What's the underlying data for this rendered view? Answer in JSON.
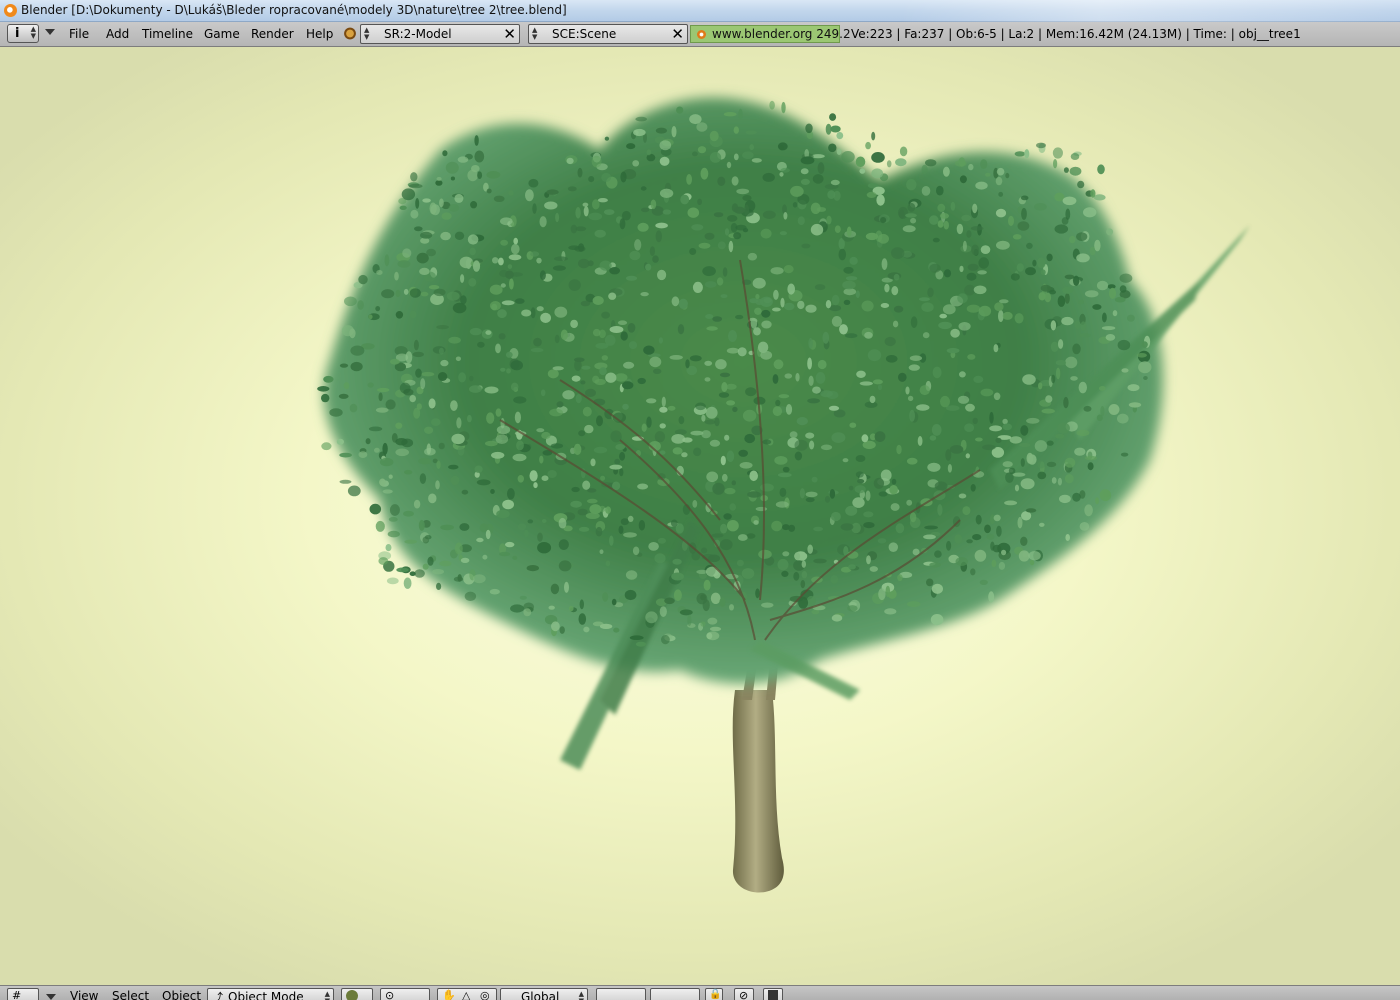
{
  "window": {
    "title": "Blender [D:\\Dokumenty - D\\Lukáš\\Bleder ropracované\\modely 3D\\nature\\tree 2\\tree.blend]",
    "app_icon": "blender-logo-icon"
  },
  "topbar": {
    "window_type_icon": "info-icon",
    "menus": [
      "File",
      "Add",
      "Timeline",
      "Game",
      "Render",
      "Help"
    ],
    "screen_field": "SR:2-Model",
    "scene_field": "SCE:Scene",
    "url": "www.blender.org 249.2",
    "stats": "Ve:223 | Fa:237 | Ob:6-5 | La:2  | Mem:16.42M (24.13M)  | Time: | obj__tree1"
  },
  "bottombar": {
    "window_type_icon": "grid-icon",
    "menus": [
      "View",
      "Select",
      "Object"
    ],
    "mode": "Object Mode",
    "transform_orientation": "Global"
  },
  "colors": {
    "viewport_center": "#fbfde6",
    "viewport_edge": "#d9ddad",
    "foliage_dark": "#2f6b3a",
    "foliage_mid": "#4f8f55",
    "foliage_light": "#8cc08a",
    "trunk": "#8f8a62"
  }
}
